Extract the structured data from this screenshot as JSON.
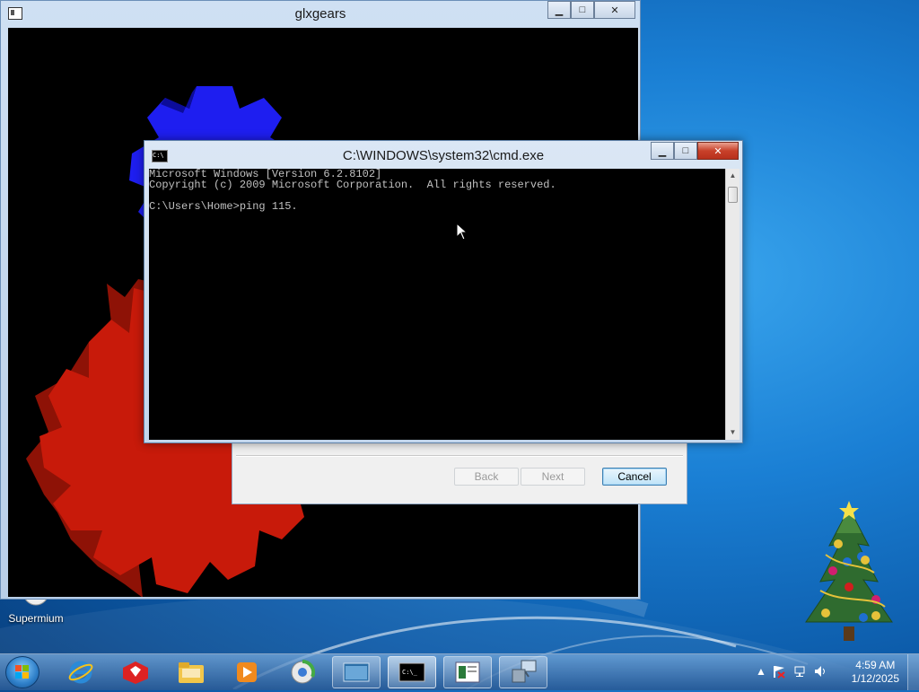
{
  "glx_window": {
    "title": "glxgears",
    "minimize_symbol": "▁",
    "maximize_symbol": "□",
    "close_symbol": "✕"
  },
  "cmd_window": {
    "title": "C:\\WINDOWS\\system32\\cmd.exe",
    "minimize_symbol": "▁",
    "maximize_symbol": "□",
    "close_symbol": "✕",
    "icon_text": "C:\\",
    "console_lines": [
      "Microsoft Windows [Version 6.2.8102]",
      "Copyright (c) 2009 Microsoft Corporation.  All rights reserved.",
      "",
      "C:\\Users\\Home>ping 115."
    ]
  },
  "wizard": {
    "back_label": "Back",
    "next_label": "Next",
    "cancel_label": "Cancel"
  },
  "desktop": {
    "icons": [
      {
        "label": "Supermium",
        "icon": "supermium-icon"
      }
    ]
  },
  "taskbar": {
    "pinned": [
      {
        "name": "internet-explorer",
        "icon": "ie-icon"
      },
      {
        "name": "red-app",
        "icon": "red-app-icon"
      },
      {
        "name": "file-explorer",
        "icon": "folder-icon"
      },
      {
        "name": "media-player",
        "icon": "media-player-icon"
      },
      {
        "name": "supermium",
        "icon": "supermium-icon"
      },
      {
        "name": "glxgears",
        "icon": "glxgears-icon"
      },
      {
        "name": "cmd",
        "icon": "cmd-icon"
      },
      {
        "name": "wizard-app",
        "icon": "wizard-icon"
      },
      {
        "name": "network-app",
        "icon": "network-icon"
      }
    ],
    "tray_icons": [
      "show-hidden-icon",
      "flag-icon",
      "network-icon",
      "volume-icon"
    ],
    "time": "4:59 AM",
    "date": "1/12/2025"
  },
  "colors": {
    "gear_red": "#c81a0a",
    "gear_blue": "#1e1ef0",
    "console_bg": "#000000",
    "console_fg": "#c0c0c0"
  }
}
